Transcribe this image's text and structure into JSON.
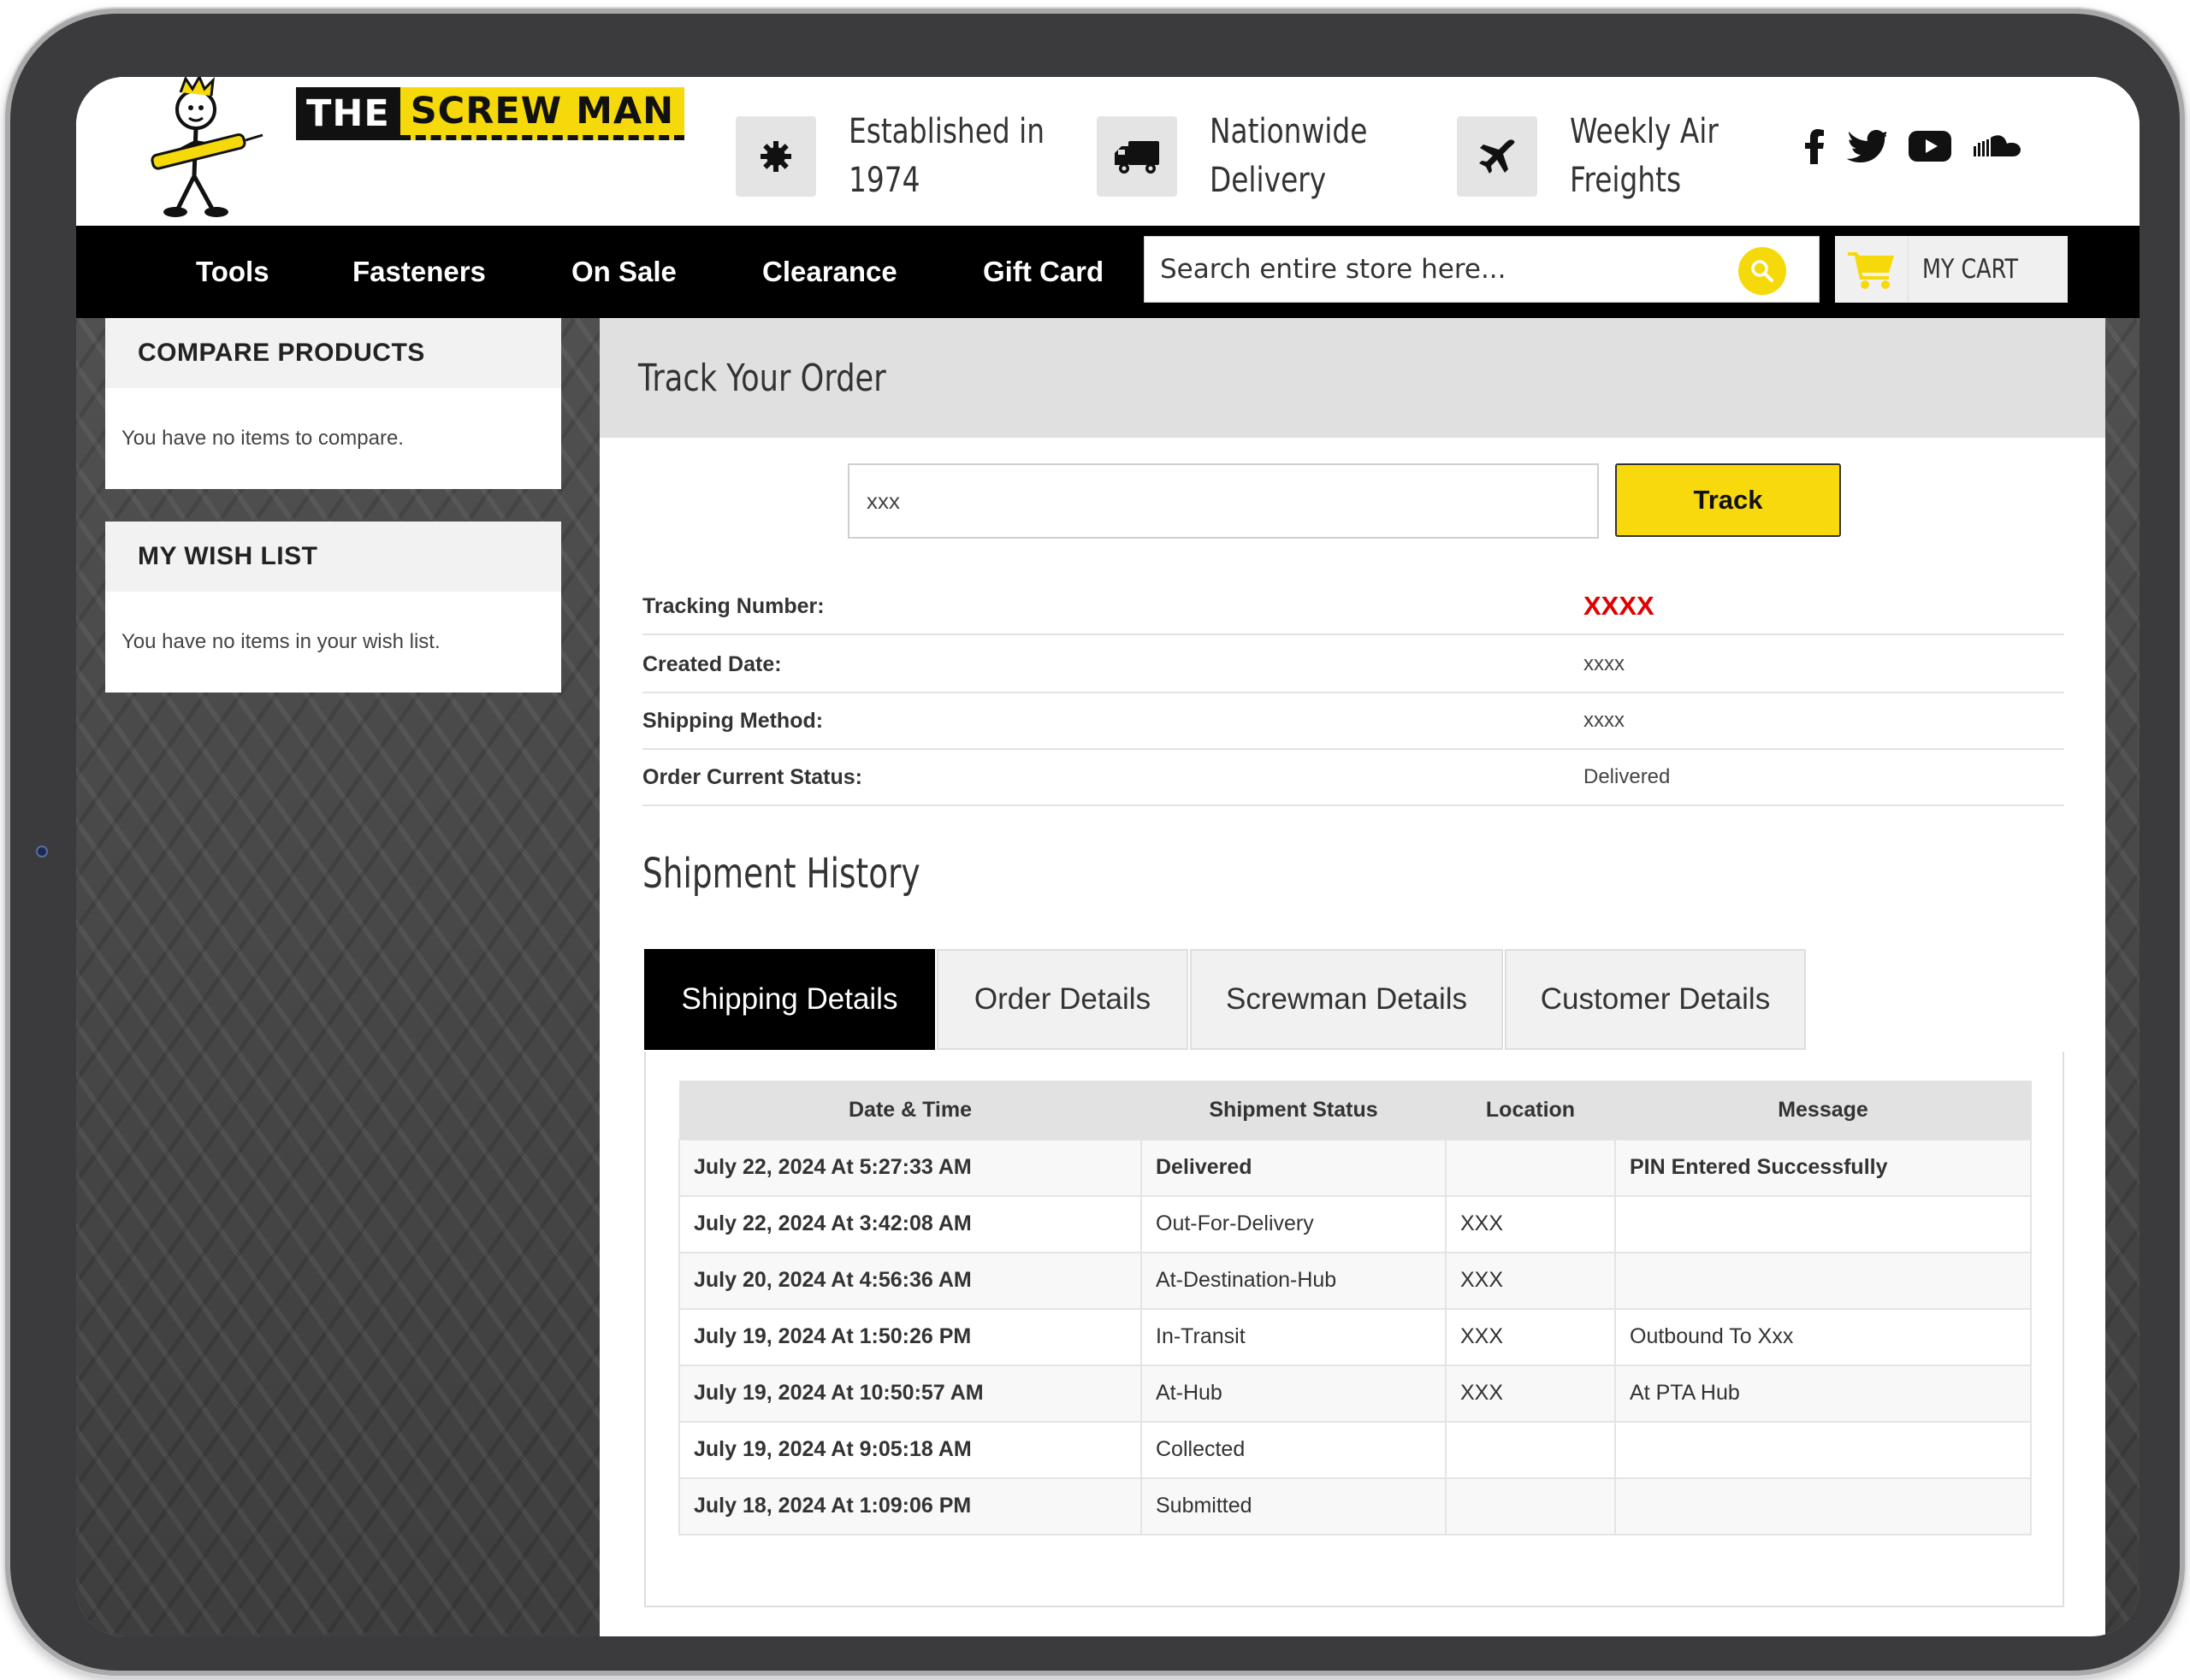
{
  "brand": {
    "logo_the": "THE",
    "logo_screwman": "SCREW MAN",
    "accent": "#f6d90a"
  },
  "features": [
    {
      "icon": "gear-icon",
      "line1": "Established in",
      "line2": "1974"
    },
    {
      "icon": "truck-icon",
      "line1": "Nationwide",
      "line2": "Delivery"
    },
    {
      "icon": "airplane-icon",
      "line1": "Weekly Air",
      "line2": "Freights"
    }
  ],
  "socials": [
    "facebook-icon",
    "twitter-icon",
    "youtube-icon",
    "soundcloud-icon"
  ],
  "nav": {
    "items": [
      "Tools",
      "Fasteners",
      "On Sale",
      "Clearance",
      "Gift Card"
    ],
    "search_placeholder": "Search entire store here...",
    "cart_label": "MY CART"
  },
  "sidebar": {
    "compare": {
      "title": "COMPARE PRODUCTS",
      "body": "You have no items to compare."
    },
    "wishlist": {
      "title": "MY WISH LIST",
      "body": "You have no items in your wish list."
    }
  },
  "track": {
    "title": "Track Your Order",
    "input_value": "xxx",
    "button_label": "Track",
    "fields": [
      {
        "label": "Tracking Number:",
        "value": "XXXX"
      },
      {
        "label": "Created Date:",
        "value": "xxxx"
      },
      {
        "label": "Shipping Method:",
        "value": "xxxx"
      },
      {
        "label": "Order Current Status:",
        "value": "Delivered"
      }
    ]
  },
  "history": {
    "title": "Shipment History",
    "tabs": [
      "Shipping Details",
      "Order Details",
      "Screwman Details",
      "Customer Details"
    ],
    "active_tab": "Shipping Details",
    "columns": [
      "Date & Time",
      "Shipment Status",
      "Location",
      "Message"
    ],
    "rows": [
      [
        "July 22, 2024 At 5:27:33 AM",
        "Delivered",
        "",
        "PIN Entered Successfully"
      ],
      [
        "July 22, 2024 At 3:42:08 AM",
        "Out-For-Delivery",
        "XXX",
        ""
      ],
      [
        "July 20, 2024 At 4:56:36 AM",
        "At-Destination-Hub",
        "XXX",
        ""
      ],
      [
        "July 19, 2024 At 1:50:26 PM",
        "In-Transit",
        "XXX",
        "Outbound To Xxx"
      ],
      [
        "July 19, 2024 At 10:50:57 AM",
        "At-Hub",
        "XXX",
        "At PTA Hub"
      ],
      [
        "July 19, 2024 At 9:05:18 AM",
        "Collected",
        "",
        ""
      ],
      [
        "July 18, 2024 At 1:09:06 PM",
        "Submitted",
        "",
        ""
      ]
    ]
  }
}
